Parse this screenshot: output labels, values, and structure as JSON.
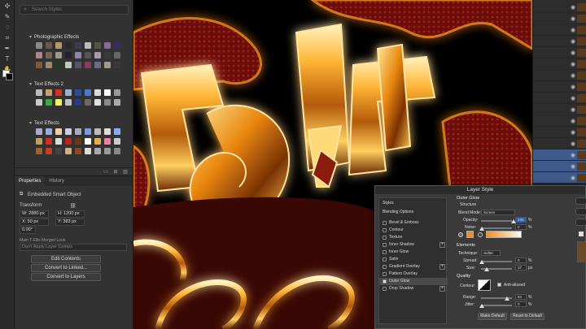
{
  "styles_panel": {
    "search_placeholder": "Search Styles",
    "groups": [
      {
        "label": "Photographic Effects"
      },
      {
        "label": "Text Effects 2"
      },
      {
        "label": "Text Effects"
      }
    ]
  },
  "properties": {
    "tabs": [
      {
        "label": "Properties"
      },
      {
        "label": "History"
      }
    ],
    "object_type": "Embedded Smart Object",
    "transform_label": "Transform",
    "w": "W: 2880 px",
    "h": "H: 1200 px",
    "x": "X: 50 px",
    "y": "Y: 383 px",
    "angle": "0.00°",
    "linked_file": "Main T-Ellis Merged Look",
    "layer_comp": "Don't Apply Layer Comps",
    "buttons": {
      "edit": "Edit Contents",
      "convert_linked": "Convert to Linked...",
      "convert_layers": "Convert to Layers"
    }
  },
  "dialog": {
    "title": "Layer Style",
    "left_header": "Styles",
    "blending_options": "Blending Options",
    "items": [
      {
        "label": "Bevel & Emboss",
        "plus": false
      },
      {
        "label": "Contour",
        "plus": false
      },
      {
        "label": "Texture",
        "plus": false
      },
      {
        "label": "Inner Shadow",
        "plus": true
      },
      {
        "label": "Inner Glow",
        "plus": false
      },
      {
        "label": "Satin",
        "plus": false
      },
      {
        "label": "Gradient Overlay",
        "plus": true
      },
      {
        "label": "Pattern Overlay",
        "plus": false
      },
      {
        "label": "Outer Glow",
        "plus": false
      },
      {
        "label": "Drop Shadow",
        "plus": true
      }
    ],
    "right": {
      "section": "Outer Glow",
      "structure": "Structure",
      "blend_mode_label": "Blend Mode:",
      "blend_mode": "Screen",
      "opacity_label": "Opacity:",
      "opacity": "100",
      "noise_label": "Noise:",
      "noise": "0",
      "elements": "Elements",
      "technique_label": "Technique:",
      "technique": "Softer",
      "spread_label": "Spread:",
      "spread": "0",
      "size_label": "Size:",
      "size": "37",
      "quality": "Quality",
      "contour_label": "Contour:",
      "anti_aliased": "Anti-aliased",
      "range_label": "Range:",
      "range": "84",
      "jitter_label": "Jitter:",
      "jitter": "0",
      "percent": "%",
      "px": "px",
      "make_default": "Make Default",
      "reset_default": "Reset to Default"
    }
  },
  "colors": {
    "glow": "#f0901a",
    "panel": "#323232"
  }
}
